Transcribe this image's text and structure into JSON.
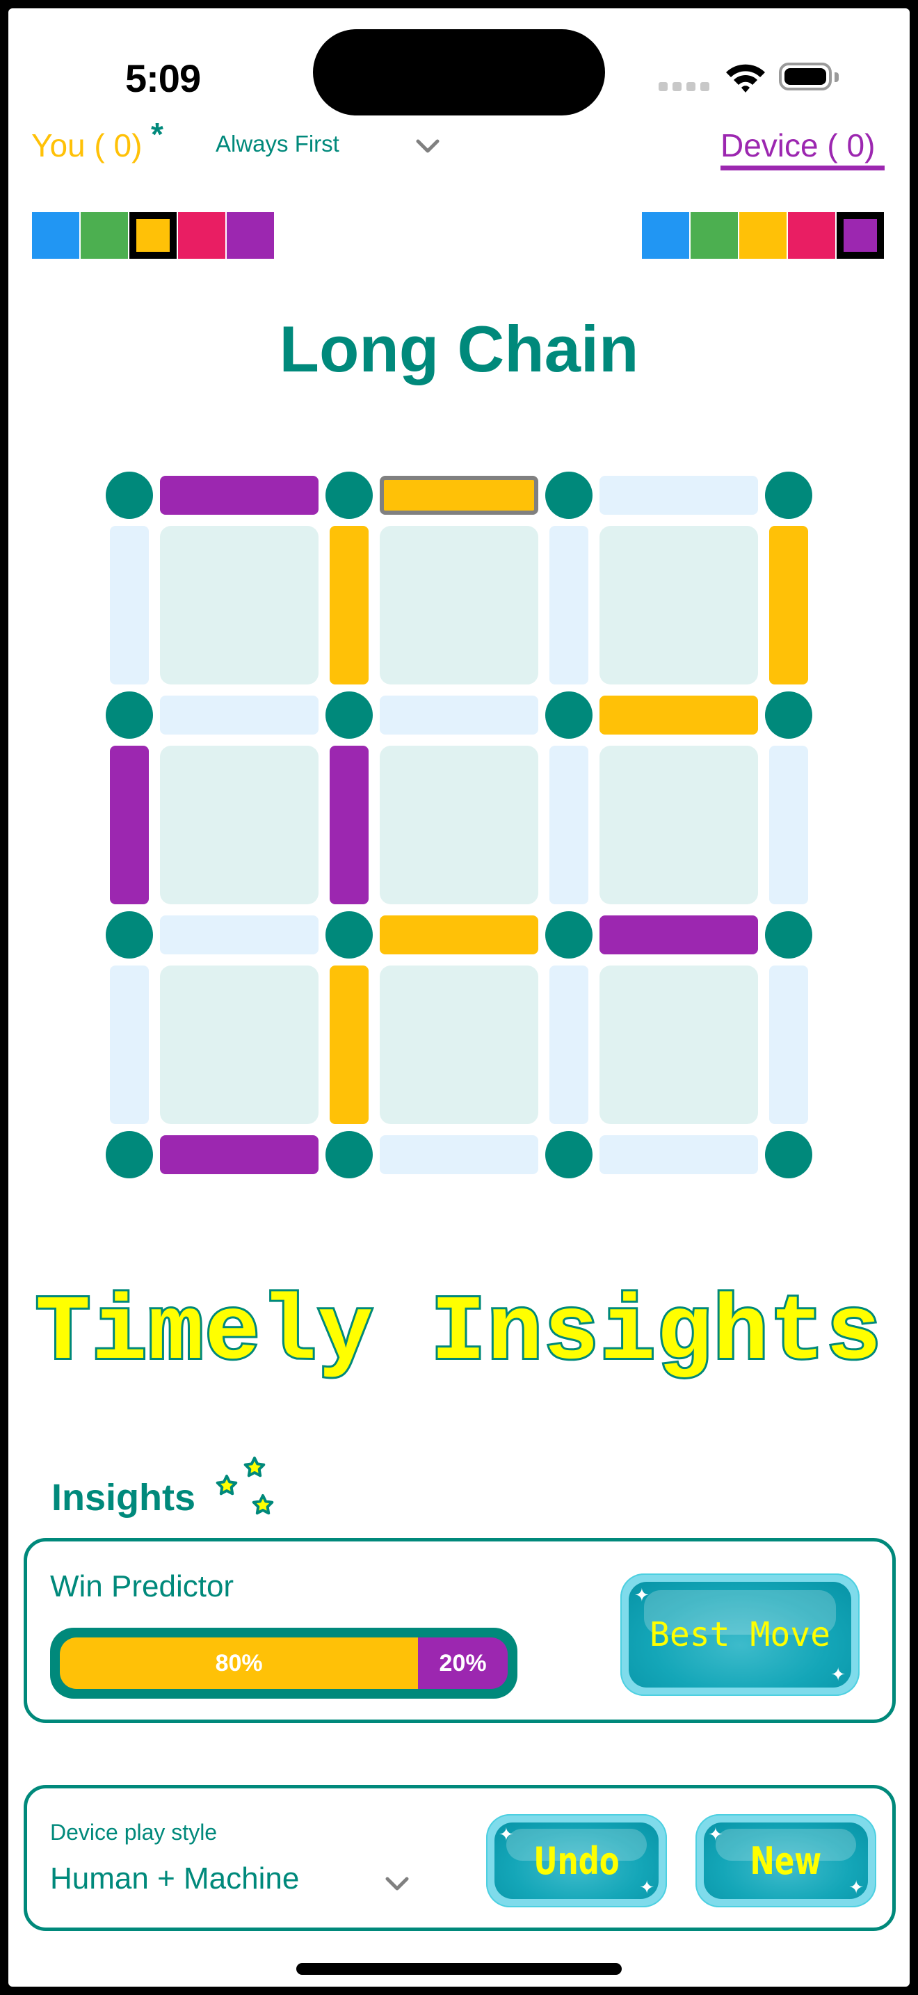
{
  "status_bar": {
    "time": "5:09",
    "icons": [
      "signal-dots-icon",
      "wifi-icon",
      "battery-icon"
    ]
  },
  "header": {
    "you_label": "You ( 0)",
    "you_turn_marker": "*",
    "turn_order_select": "Always First",
    "device_label": "Device ( 0)",
    "active_player": "device"
  },
  "palettes": {
    "colors": [
      "#2196F3",
      "#4CAF50",
      "#FFC107",
      "#E91E63",
      "#9C27B0"
    ],
    "you_selected_index": 2,
    "device_selected_index": 4
  },
  "game": {
    "title": "Long Chain",
    "grid_size": 3,
    "colors": {
      "dot": "#00897B",
      "empty_line": "#E3F2FD",
      "box": "#E0F2F1",
      "you": "#FFC107",
      "device": "#9C27B0",
      "last_move_border": "#808080"
    },
    "h_lines": [
      [
        "device",
        "you",
        null
      ],
      [
        null,
        null,
        "you"
      ],
      [
        null,
        "you",
        "device"
      ],
      [
        "device",
        null,
        null
      ]
    ],
    "v_lines": [
      [
        null,
        "you",
        null,
        "you"
      ],
      [
        "device",
        "device",
        null,
        null
      ],
      [
        null,
        "you",
        null,
        null
      ]
    ],
    "last_move": {
      "type": "h",
      "row": 0,
      "col": 1
    }
  },
  "banner": {
    "text": "Timely Insights"
  },
  "insights": {
    "label": "Insights",
    "icon": "stars-icon",
    "win_predictor": {
      "label": "Win Predictor",
      "you_percent": 80,
      "device_percent": 20,
      "you_text": "80%",
      "device_text": "20%"
    },
    "best_move_label": "Best Move"
  },
  "controls": {
    "play_style_label": "Device play style",
    "play_style_value": "Human + Machine",
    "undo_label": "Undo",
    "new_label": "New"
  }
}
